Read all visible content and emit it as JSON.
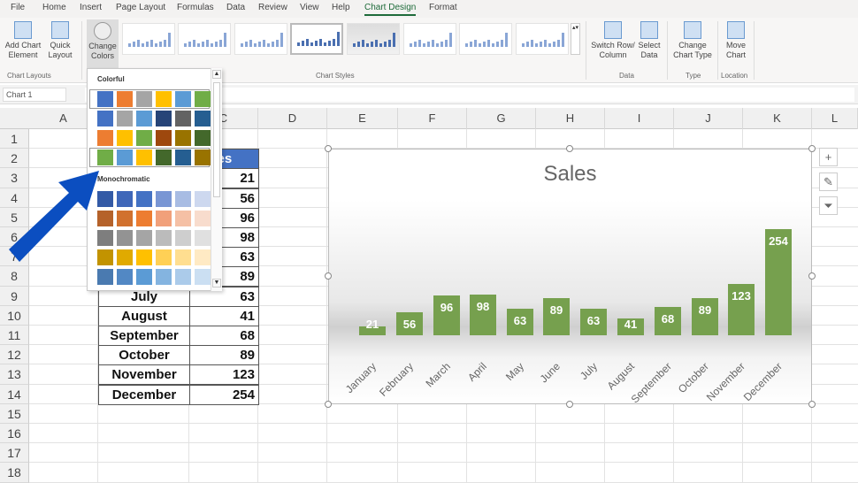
{
  "tabs": [
    "File",
    "Home",
    "Insert",
    "Page Layout",
    "Formulas",
    "Data",
    "Review",
    "View",
    "Help",
    "Chart Design",
    "Format"
  ],
  "active_tab": "Chart Design",
  "ribbon": {
    "add_chart_element": "Add Chart Element",
    "quick_layout": "Quick Layout",
    "change_colors": "Change Colors",
    "switch_row_column": "Switch Row/ Column",
    "select_data": "Select Data",
    "change_chart_type": "Change Chart Type",
    "move_chart": "Move Chart",
    "groups": {
      "chart_layouts": "Chart Layouts",
      "chart_styles": "Chart Styles",
      "data": "Data",
      "type": "Type",
      "location": "Location"
    }
  },
  "name_box": "Chart 1",
  "columns": [
    "A",
    "B",
    "C",
    "D",
    "E",
    "F",
    "G",
    "H",
    "I",
    "J",
    "K",
    "L"
  ],
  "rows": [
    "1",
    "2",
    "3",
    "4",
    "5",
    "6",
    "7",
    "8",
    "9",
    "10",
    "11",
    "12",
    "13",
    "14",
    "15",
    "16",
    "17",
    "18"
  ],
  "table": {
    "header": "Sales",
    "months": [
      "January",
      "February",
      "March",
      "April",
      "May",
      "June",
      "July",
      "August",
      "September",
      "October",
      "November",
      "December"
    ],
    "values": [
      "21",
      "56",
      "96",
      "98",
      "63",
      "89",
      "63",
      "41",
      "68",
      "89",
      "123",
      "254"
    ]
  },
  "dropdown": {
    "colorful_label": "Colorful",
    "monochromatic_label": "Monochromatic",
    "colorful": [
      [
        "#4472C4",
        "#ED7D31",
        "#A5A5A5",
        "#FFC000",
        "#5B9BD5",
        "#70AD47"
      ],
      [
        "#4472C4",
        "#A5A5A5",
        "#5B9BD5",
        "#264478",
        "#636363",
        "#255E91"
      ],
      [
        "#ED7D31",
        "#FFC000",
        "#70AD47",
        "#9E480E",
        "#997300",
        "#43682B"
      ],
      [
        "#70AD47",
        "#5B9BD5",
        "#FFC000",
        "#43682B",
        "#255E91",
        "#997300"
      ]
    ],
    "monochromatic": [
      [
        "#335AA6",
        "#3F67B9",
        "#4472C4",
        "#7996D4",
        "#A8BCE3",
        "#CDD8EF"
      ],
      [
        "#B5622A",
        "#D1712E",
        "#ED7D31",
        "#F1A07A",
        "#F5C0A5",
        "#F8DCCD"
      ],
      [
        "#7E7E7E",
        "#939393",
        "#A5A5A5",
        "#BBBBBB",
        "#CECECE",
        "#E0E0E0"
      ],
      [
        "#C29300",
        "#E0AA00",
        "#FFC000",
        "#FFD055",
        "#FFDE90",
        "#FFEAC4"
      ],
      [
        "#4A7AB0",
        "#5288C4",
        "#5B9BD5",
        "#84B4E0",
        "#ABCBEA",
        "#CBDFF2"
      ]
    ]
  },
  "chart_data": {
    "type": "bar",
    "title": "Sales",
    "categories": [
      "January",
      "February",
      "March",
      "April",
      "May",
      "June",
      "July",
      "August",
      "September",
      "October",
      "November",
      "December"
    ],
    "values": [
      21,
      56,
      96,
      98,
      63,
      89,
      63,
      41,
      68,
      89,
      123,
      254
    ],
    "bar_color": "#76A04E",
    "data_labels": true,
    "grid": false
  },
  "colors": {
    "header_fill": "#4472C4",
    "accent": "#1E6B3A",
    "arrow": "#0B4EC0"
  }
}
